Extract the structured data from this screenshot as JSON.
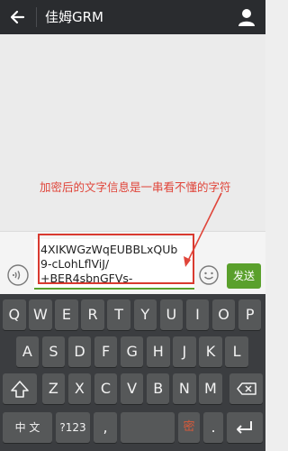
{
  "header": {
    "title": "佳姆GRM",
    "back_icon": "back-arrow-icon",
    "profile_icon": "person-icon"
  },
  "annotation": {
    "text": "加密后的文字信息是一串看不懂的字符",
    "color": "#e0453a"
  },
  "composer": {
    "message_lines": [
      "4XIKWGzWqEUBBLxQUb",
      "9-cLohLflViJ/",
      "+BER4sbnGFVs-"
    ],
    "send_label": "发送",
    "voice_icon": "voice-icon",
    "emoji_icon": "emoji-icon",
    "accent": "#5aa02c"
  },
  "keyboard": {
    "row1": [
      "Q",
      "W",
      "E",
      "R",
      "T",
      "Y",
      "U",
      "I",
      "O",
      "P"
    ],
    "row2": [
      "A",
      "S",
      "D",
      "F",
      "G",
      "H",
      "J",
      "K",
      "L"
    ],
    "row3": [
      "Z",
      "X",
      "C",
      "V",
      "B",
      "N",
      "M"
    ],
    "lang_label": "中 文",
    "sym_label": "?123",
    "comma_label": ",",
    "encrypt_label": "密",
    "period_label": ".",
    "shift_icon": "shift-icon",
    "delete_icon": "delete-icon",
    "enter_icon": "enter-icon"
  }
}
